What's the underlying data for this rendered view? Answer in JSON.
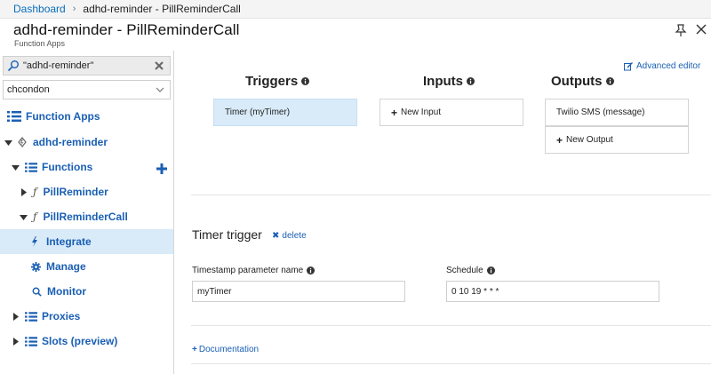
{
  "breadcrumb": {
    "root": "Dashboard",
    "current": "adhd-reminder - PillReminderCall"
  },
  "blade": {
    "title": "adhd-reminder - PillReminderCall",
    "subtitle": "Function Apps"
  },
  "sidebar": {
    "search": {
      "value": "\"adhd-reminder\""
    },
    "subscription": "chcondon",
    "items": [
      {
        "label": "Function Apps"
      },
      {
        "label": "adhd-reminder"
      },
      {
        "label": "Functions"
      },
      {
        "label": "PillReminder"
      },
      {
        "label": "PillReminderCall"
      },
      {
        "label": "Integrate"
      },
      {
        "label": "Manage"
      },
      {
        "label": "Monitor"
      },
      {
        "label": "Proxies"
      },
      {
        "label": "Slots (preview)"
      }
    ]
  },
  "main": {
    "advanced_editor": "Advanced editor",
    "triggers": {
      "header": "Triggers",
      "items": [
        "Timer (myTimer)"
      ]
    },
    "inputs": {
      "header": "Inputs",
      "new_label": "New Input"
    },
    "outputs": {
      "header": "Outputs",
      "items": [
        "Twilio SMS (message)"
      ],
      "new_label": "New Output"
    },
    "trigger_section": {
      "title": "Timer trigger",
      "delete_label": "delete",
      "timestamp_label": "Timestamp parameter name",
      "timestamp_value": "myTimer",
      "schedule_label": "Schedule",
      "schedule_value": "0 10 19 * * *"
    },
    "documentation_label": "Documentation"
  },
  "colors": {
    "accent": "#1a5fb4",
    "selected_bg": "#d9ebf9"
  }
}
